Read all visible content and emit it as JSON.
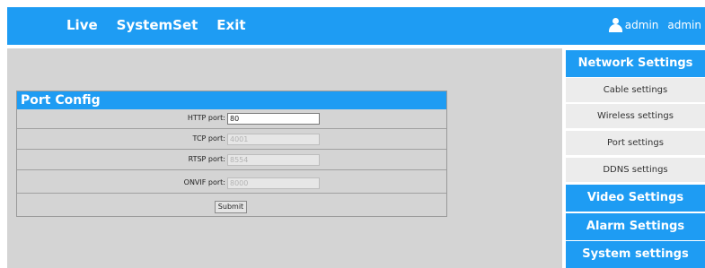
{
  "header": {
    "nav": [
      "Live",
      "SystemSet",
      "Exit"
    ],
    "user_label": "admin",
    "user_name": "admin"
  },
  "port_config": {
    "title": "Port Config",
    "fields": [
      {
        "label": "HTTP port:",
        "value": "80"
      },
      {
        "label": "TCP port:",
        "value": "4001"
      },
      {
        "label": "RTSP port:",
        "value": "8554"
      },
      {
        "label": "ONVIF port:",
        "value": "8000"
      }
    ],
    "submit_label": "Submit"
  },
  "sidebar": {
    "network": "Network Settings",
    "items": [
      "Cable settings",
      "Wireless settings",
      "Port settings",
      "DDNS settings"
    ],
    "video": "Video Settings",
    "alarm": "Alarm Settings",
    "system": "System settings"
  },
  "colors": {
    "accent": "#1e9cf3",
    "panel_bg": "#d4d4d4"
  }
}
